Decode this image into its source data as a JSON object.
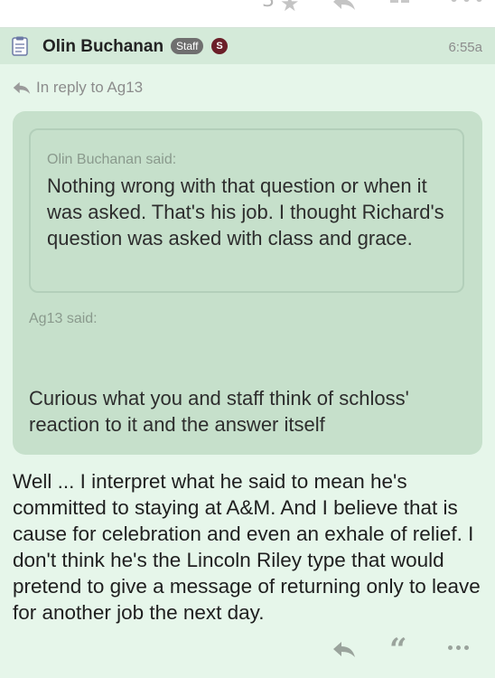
{
  "top_bar": {
    "reaction_count": "3"
  },
  "post": {
    "author": "Olin Buchanan",
    "staff_badge": "Staff",
    "team_badge": "S",
    "time": "6:55a",
    "in_reply_to": "In reply to Ag13",
    "nested_quote": {
      "attribution": "Olin Buchanan said:",
      "text": "Nothing wrong with that question or when it was asked. That's his job. I thought Richard's question was asked with class and grace."
    },
    "quote": {
      "attribution": "Ag13 said:",
      "text": "Curious what you and staff think of schloss' reaction to it and the answer itself"
    },
    "body": "Well ... I interpret what he said to mean he's committed to staying at A&M. And I believe that is cause for celebration and even an exhale of relief. I don't think he's the Lincoln Riley type that would pretend to give a message of returning only to leave for another job the next day."
  },
  "icons": {
    "star": "star-icon",
    "reply": "reply-icon",
    "quote": "quote-icon",
    "more": "more-icon",
    "grid": "grid-icon",
    "post": "document-icon"
  },
  "colors": {
    "background": "#e6f6ea",
    "header": "#d4ead9",
    "quote_box": "#c6e0cb",
    "team_badge": "#6b1f28"
  }
}
